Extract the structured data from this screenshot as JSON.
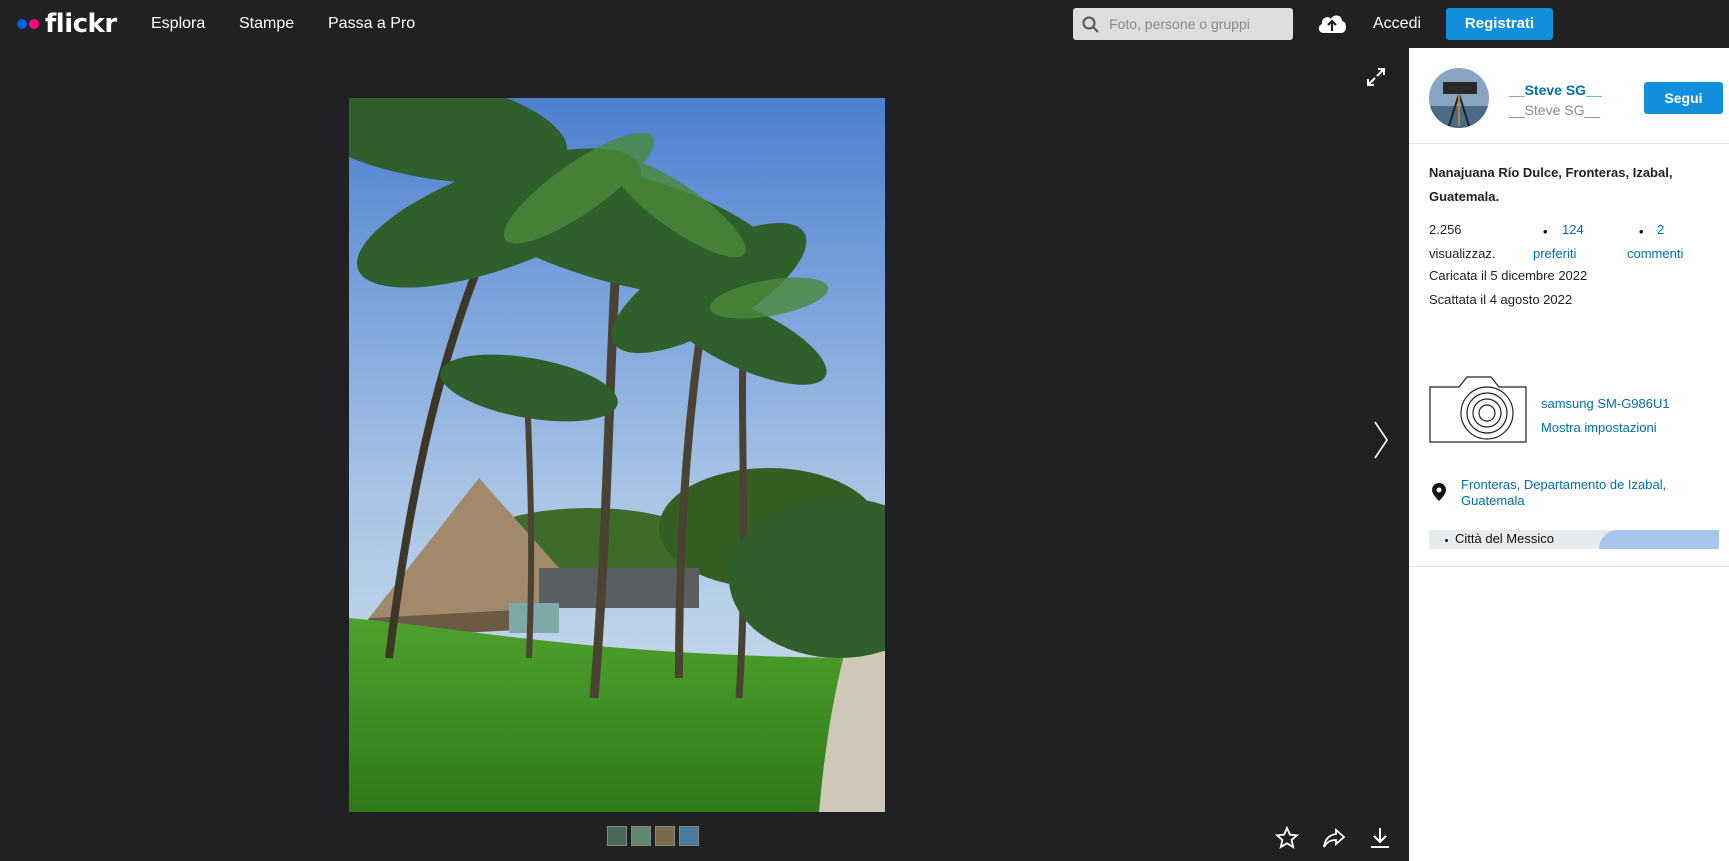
{
  "brand": {
    "name": "flickr"
  },
  "nav": {
    "explore": "Esplora",
    "prints": "Stampe",
    "pro": "Passa a Pro"
  },
  "search": {
    "placeholder": "Foto, persone o gruppi"
  },
  "auth": {
    "login": "Accedi",
    "signup": "Registrati"
  },
  "owner": {
    "name": "__Steve SG__",
    "subname": "__Steve SG__",
    "follow": "Segui"
  },
  "photo": {
    "title": "Nanajuana Río Dulce, Fronteras, Izabal, Guatemala."
  },
  "stats": {
    "views_count": "2.256",
    "views_label": "visualizzaz.",
    "faves_count": "124",
    "faves_label": "preferiti",
    "comments_count": "2",
    "comments_label": "commenti",
    "uploaded": "Caricata il 5 dicembre 2022",
    "taken": "Scattata il 4 agosto 2022"
  },
  "camera": {
    "model": "samsung SM-G986U1",
    "settings": "Mostra impostazioni"
  },
  "location": {
    "name": "Fronteras, Departamento de Izabal, Guatemala",
    "map_label": "Città del Messico"
  },
  "icons": [
    "search-icon",
    "upload-cloud-icon",
    "expand-icon",
    "next-arrow-icon",
    "star-icon",
    "share-icon",
    "download-icon",
    "camera-icon",
    "location-pin-icon"
  ],
  "colors": {
    "accent": "#128fdc",
    "link": "#006dac",
    "background": "#212124"
  }
}
